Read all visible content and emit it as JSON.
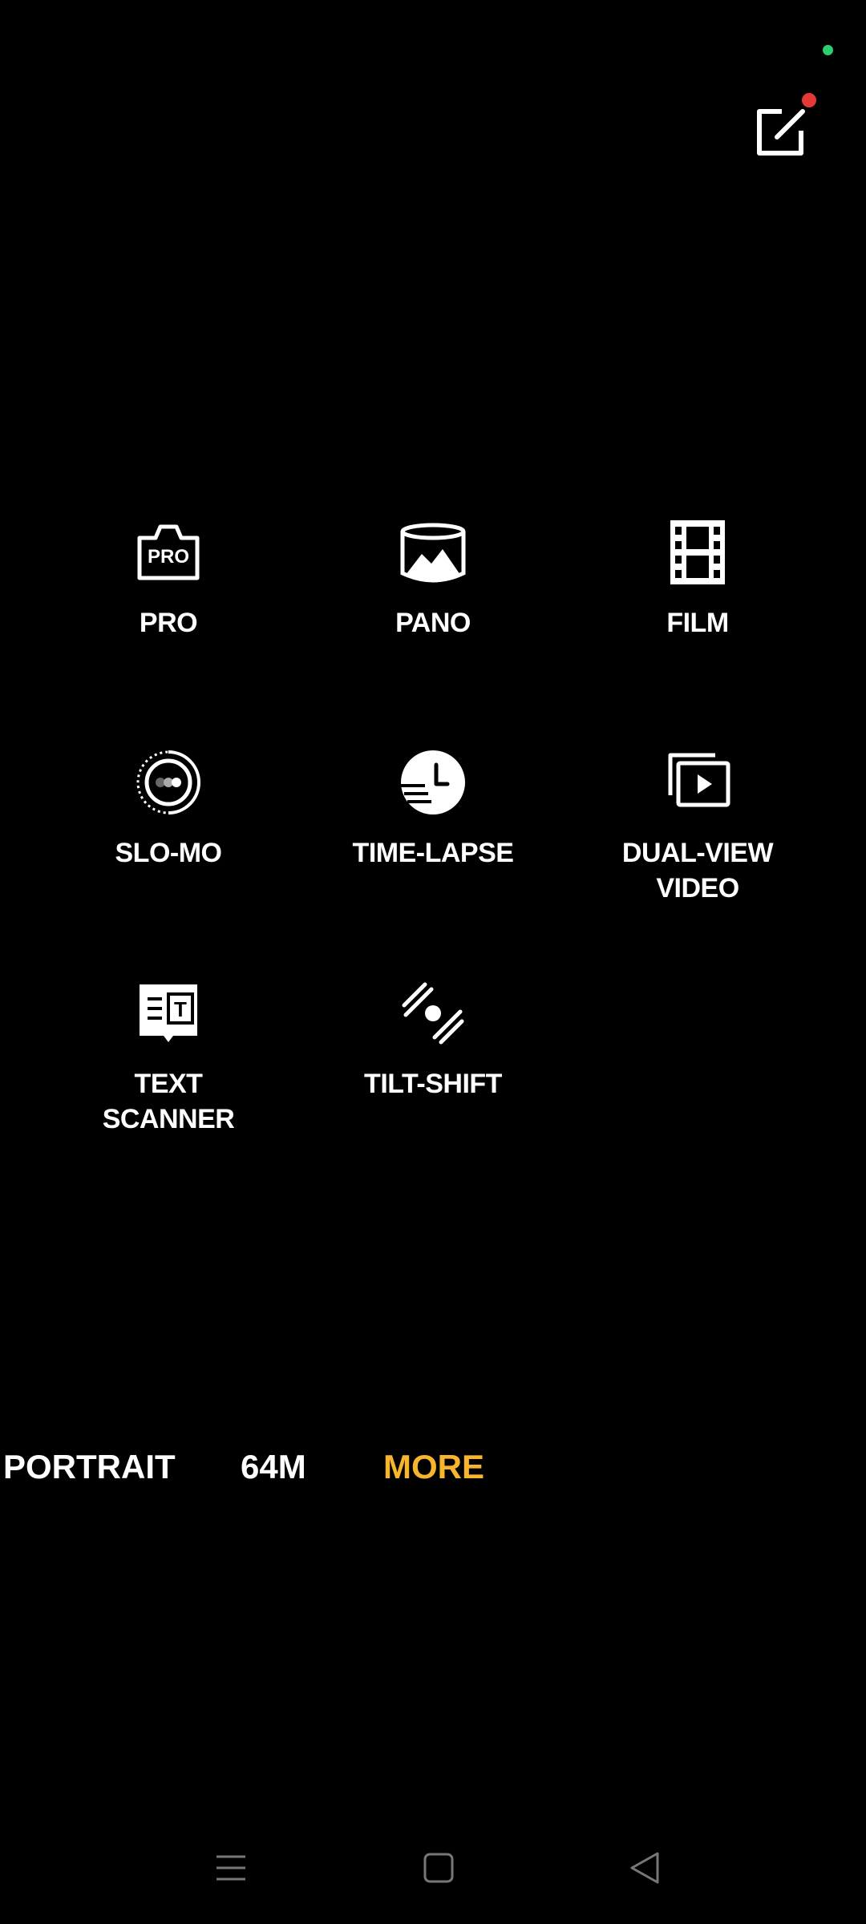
{
  "colors": {
    "background": "#000000",
    "text": "#ffffff",
    "accent": "#f6b52c",
    "status_dot": "#2ecc71",
    "notification_dot": "#e53935",
    "nav_icon": "#777777"
  },
  "top": {
    "edit_icon": "edit-icon"
  },
  "modes": [
    {
      "id": "pro",
      "label": "PRO",
      "icon_text": "PRO",
      "icon": "pro-icon"
    },
    {
      "id": "pano",
      "label": "PANO",
      "icon": "pano-icon"
    },
    {
      "id": "film",
      "label": "FILM",
      "icon": "film-icon"
    },
    {
      "id": "slo-mo",
      "label": "SLO-MO",
      "icon": "slo-mo-icon"
    },
    {
      "id": "time-lapse",
      "label": "TIME-LAPSE",
      "icon": "time-lapse-icon"
    },
    {
      "id": "dual-view-video",
      "label": "DUAL-VIEW\nVIDEO",
      "icon": "dual-view-video-icon"
    },
    {
      "id": "text-scanner",
      "label": "TEXT\nSCANNER",
      "icon_text": "T",
      "icon": "text-scanner-icon"
    },
    {
      "id": "tilt-shift",
      "label": "TILT-SHIFT",
      "icon": "tilt-shift-icon"
    }
  ],
  "tabs": {
    "portrait": "PORTRAIT",
    "megapixel": "64M",
    "more": "MORE",
    "active": "more"
  },
  "navbar": {
    "recents_icon": "menu-icon",
    "home_icon": "home-square-icon",
    "back_icon": "back-triangle-icon"
  }
}
